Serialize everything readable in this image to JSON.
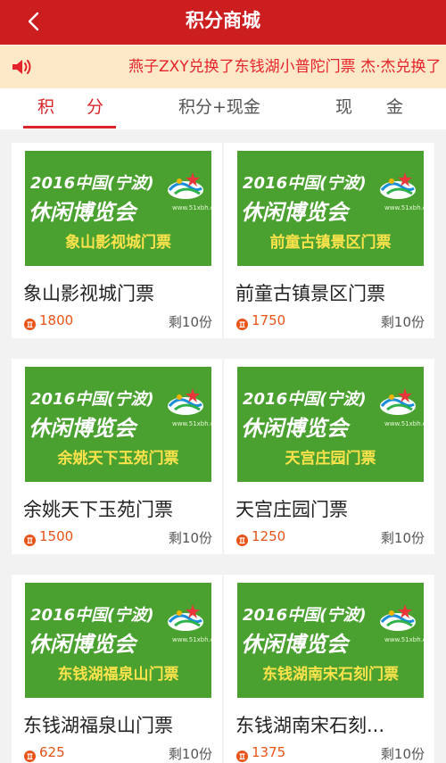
{
  "header": {
    "title": "积分商城"
  },
  "marquee": {
    "text": "燕子ZXY兑换了东钱湖小普陀门票   杰·杰兑换了"
  },
  "tabs": [
    {
      "label": "积分",
      "active": true
    },
    {
      "label": "积分+现金",
      "active": false
    },
    {
      "label": "现金",
      "active": false
    }
  ],
  "banner": {
    "year": "2016中国(宁波)",
    "expo": "休闲博览会",
    "url": "www.51xbh.com"
  },
  "products": [
    {
      "title": "象山影视城门票",
      "ticket": "象山影视城门票",
      "points": "1800",
      "stock": "剩10份"
    },
    {
      "title": "前童古镇景区门票",
      "ticket": "前童古镇景区门票",
      "points": "1750",
      "stock": "剩10份"
    },
    {
      "title": "余姚天下玉苑门票",
      "ticket": "余姚天下玉苑门票",
      "points": "1500",
      "stock": "剩10份"
    },
    {
      "title": "天宫庄园门票",
      "ticket": "天宫庄园门票",
      "points": "1250",
      "stock": "剩10份"
    },
    {
      "title": "东钱湖福泉山门票",
      "ticket": "东钱湖福泉山门票",
      "points": "625",
      "stock": "剩10份"
    },
    {
      "title": "东钱湖南宋石刻...",
      "ticket": "东钱湖南宋石刻门票",
      "points": "1375",
      "stock": "剩10份"
    }
  ],
  "colors": {
    "header": "#cc1d1f",
    "marquee_bg": "#fde8c8",
    "accent": "#d9262a",
    "price": "#e85318",
    "banner_bg": "#4aa12f",
    "banner_ticket_text": "#ffe34d"
  }
}
